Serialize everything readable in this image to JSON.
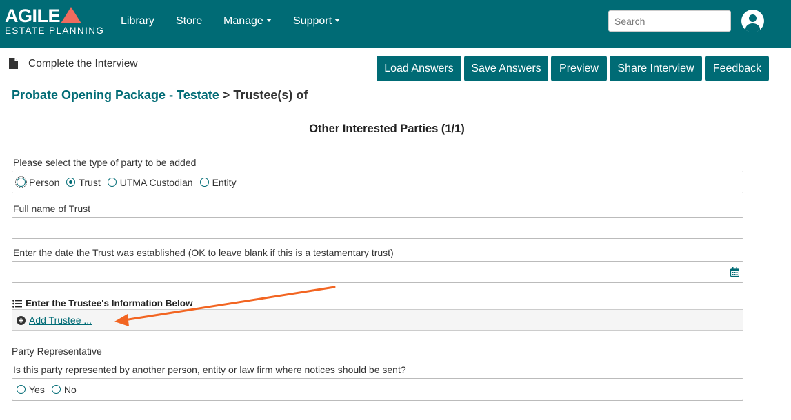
{
  "brand": {
    "name": "AGILE",
    "tagline": "ESTATE PLANNING",
    "accent": "#ef6b5e",
    "primary": "#006b75"
  },
  "nav": {
    "library": "Library",
    "store": "Store",
    "manage": "Manage",
    "support": "Support",
    "search_placeholder": "Search"
  },
  "subheader": {
    "title": "Complete the Interview",
    "buttons": {
      "load": "Load Answers",
      "save": "Save Answers",
      "preview": "Preview",
      "share": "Share Interview",
      "feedback": "Feedback"
    }
  },
  "breadcrumb": {
    "link": "Probate Opening Package - Testate",
    "separator": ">",
    "current": "Trustee(s) of"
  },
  "form": {
    "section_title": "Other Interested Parties (1/1)",
    "party_type": {
      "label": "Please select the type of party to be added",
      "options": [
        "Person",
        "Trust",
        "UTMA Custodian",
        "Entity"
      ],
      "selected": "Trust"
    },
    "full_name": {
      "label": "Full name of Trust",
      "value": ""
    },
    "date": {
      "label": "Enter the date the Trust was established (OK to leave blank if this is a testamentary trust)",
      "value": ""
    },
    "trustee_list": {
      "label": "Enter the Trustee's Information Below",
      "add_link": "Add Trustee ..."
    },
    "representative": {
      "heading": "Party Representative",
      "question": "Is this party represented by another person, entity or law firm where notices should be sent?",
      "options": [
        "Yes",
        "No"
      ]
    }
  },
  "icons": {
    "document": "document-icon",
    "calendar": "calendar-icon",
    "list": "list-icon",
    "plus": "plus-circle-icon",
    "user": "user-icon"
  },
  "annotation_color": "#f26522"
}
